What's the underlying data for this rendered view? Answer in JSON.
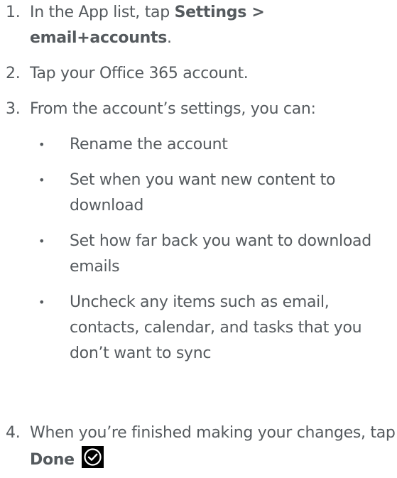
{
  "steps": [
    {
      "number": "1.",
      "text_before": "In the App list, tap ",
      "bold": "Settings > email+accounts",
      "text_after": "."
    },
    {
      "number": "2.",
      "text": "Tap your Office 365 account."
    },
    {
      "number": "3.",
      "text": "From the account’s settings, you can:",
      "bullets": [
        "Rename the account",
        "Set when you want new content to download",
        "Set how far back you want to download emails",
        "Uncheck any items such as email, contacts, calendar, and tasks that you don’t want to sync"
      ]
    },
    {
      "number": "4.",
      "text_before": "When you’re finished making your changes, tap ",
      "bold": "Done",
      "icon": "done-checkmark-icon"
    }
  ],
  "bullet_glyph": "•",
  "colors": {
    "text": "#555a5e",
    "icon_background": "#000000",
    "icon_foreground": "#ffffff"
  }
}
